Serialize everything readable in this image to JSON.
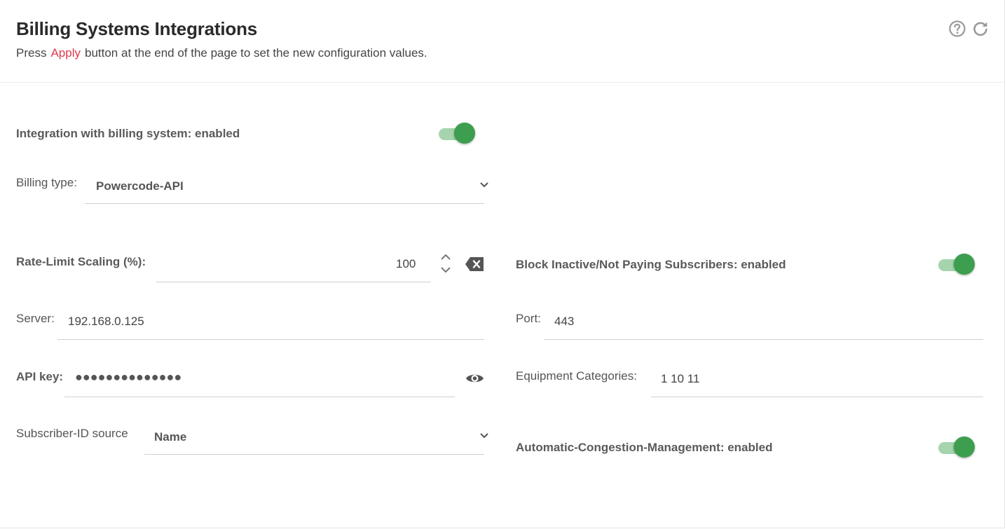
{
  "header": {
    "title": "Billing Systems Integrations",
    "subtitle_prefix": "Press",
    "subtitle_apply": "Apply",
    "subtitle_suffix": "button at the end of the page to set the new configuration values.",
    "icons": [
      "help-icon",
      "refresh-icon"
    ]
  },
  "integration": {
    "label": "Integration with billing system: enabled",
    "enabled": true
  },
  "billing_type": {
    "label": "Billing type:",
    "value": "Powercode-API"
  },
  "rate_limit": {
    "label": "Rate-Limit Scaling (%):",
    "value": "100"
  },
  "block_inactive": {
    "label": "Block Inactive/Not Paying Subscribers: enabled",
    "enabled": true
  },
  "server": {
    "label": "Server:",
    "value": "192.168.0.125"
  },
  "port": {
    "label": "Port:",
    "value": "443"
  },
  "api_key": {
    "label": "API key:",
    "masked_value": "●●●●●●●●●●●●●●"
  },
  "equipment_categories": {
    "label": "Equipment Categories:",
    "value": "1 10 11"
  },
  "subscriber_id": {
    "label": "Subscriber-ID source",
    "value": "Name"
  },
  "congestion": {
    "label": "Automatic-Congestion-Management: enabled",
    "enabled": true
  },
  "colors": {
    "accent": "#e0384b",
    "toggle_on": "#3c9e4e",
    "toggle_track": "#a5d4ad"
  }
}
